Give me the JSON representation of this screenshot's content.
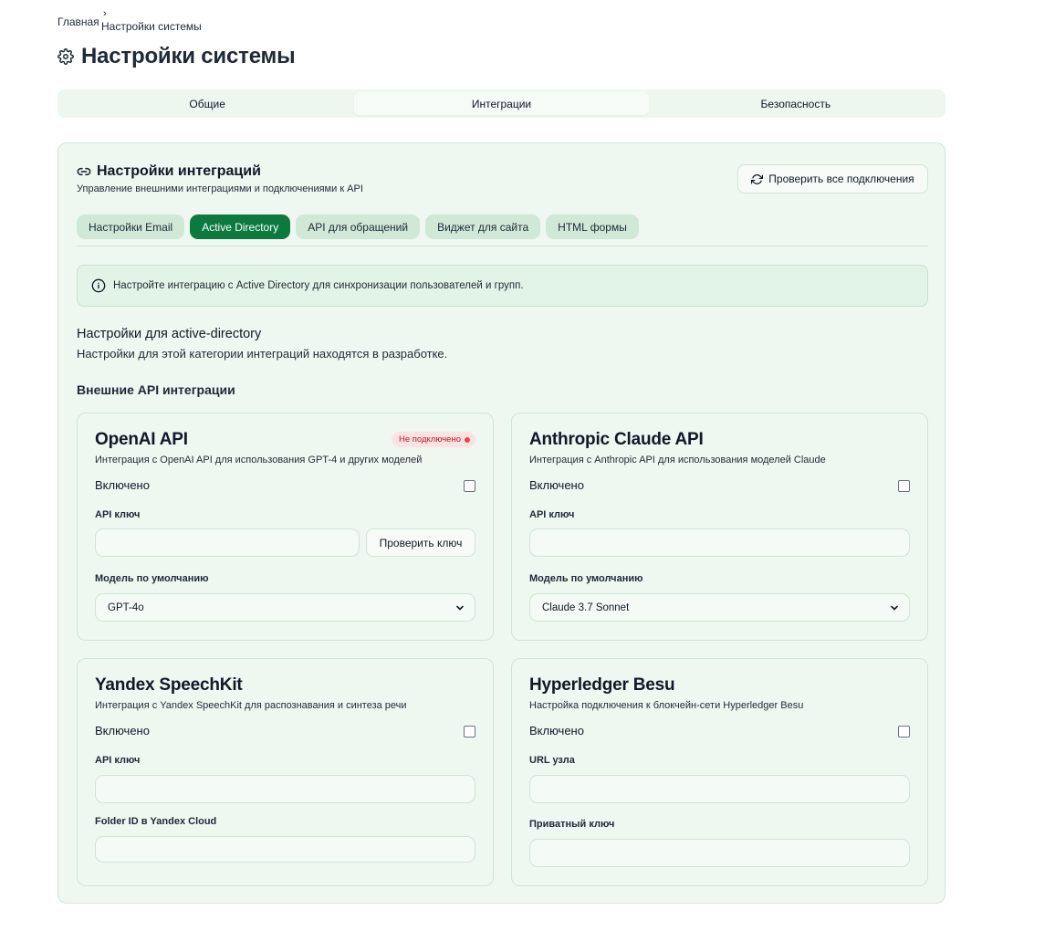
{
  "breadcrumb": {
    "home": "Главная",
    "separator": "›",
    "current": "Настройки системы"
  },
  "page": {
    "title": "Настройки системы",
    "icon": "gear-icon"
  },
  "main_tabs": [
    {
      "label": "Общие",
      "active": false
    },
    {
      "label": "Интеграции",
      "active": true
    },
    {
      "label": "Безопасность",
      "active": false
    }
  ],
  "panel": {
    "title": "Настройки интеграций",
    "icon": "link-icon",
    "subtitle": "Управление внешними интеграциями и подключениями к API",
    "check_all_label": "Проверить все подключения",
    "check_all_icon": "refresh-icon"
  },
  "sub_tabs": [
    {
      "label": "Настройки Email",
      "active": false
    },
    {
      "label": "Active Directory",
      "active": true
    },
    {
      "label": "API для обращений",
      "active": false
    },
    {
      "label": "Виджет для сайта",
      "active": false
    },
    {
      "label": "HTML формы",
      "active": false
    }
  ],
  "info": {
    "icon": "info-icon",
    "text": "Настройте интеграцию с Active Directory для синхронизации пользователей и групп."
  },
  "section": {
    "title": "Настройки для active-directory",
    "text": "Настройки для этой категории интеграций находятся в разработке."
  },
  "external_title": "Внешние API интеграции",
  "cards": {
    "openai": {
      "title": "OpenAI API",
      "badge": "Не подключено",
      "description": "Интеграция с OpenAI API для использования GPT-4 и других моделей",
      "enabled_label": "Включено",
      "enabled": false,
      "key_label": "API ключ",
      "key_value": "",
      "verify_label": "Проверить ключ",
      "model_label": "Модель по умолчанию",
      "model_value": "GPT-4o"
    },
    "anthropic": {
      "title": "Anthropic Claude API",
      "description": "Интеграция с Anthropic API для использования моделей Claude",
      "enabled_label": "Включено",
      "enabled": false,
      "key_label": "API ключ",
      "key_value": "",
      "model_label": "Модель по умолчанию",
      "model_value": "Claude 3.7 Sonnet"
    },
    "yandex": {
      "title": "Yandex SpeechKit",
      "description": "Интеграция с Yandex SpeechKit для распознавания и синтеза речи",
      "enabled_label": "Включено",
      "enabled": false,
      "key_label": "API ключ",
      "key_value": "",
      "folder_label": "Folder ID в Yandex Cloud",
      "folder_value": ""
    },
    "besu": {
      "title": "Hyperledger Besu",
      "description": "Настройка подключения к блокчейн-сети Hyperledger Besu",
      "enabled_label": "Включено",
      "enabled": false,
      "url_label": "URL узла",
      "url_value": "",
      "private_key_label": "Приватный ключ",
      "private_key_value": ""
    }
  },
  "colors": {
    "accent": "#0b7a3e",
    "panel_bg": "#eff7f1",
    "tab_pill": "#cfe9d6",
    "badge_bg": "#fde2e2",
    "badge_text": "#b91c1c"
  }
}
